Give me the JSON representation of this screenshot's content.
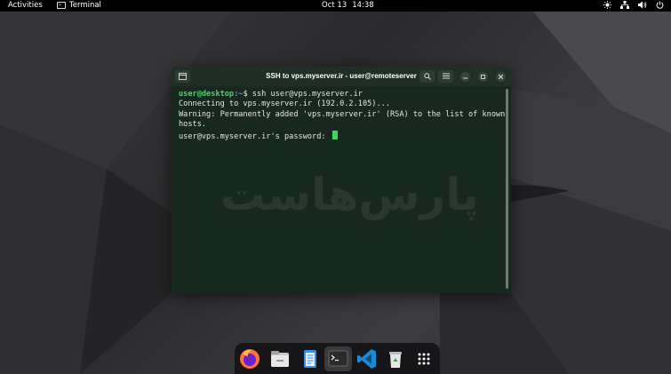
{
  "topbar": {
    "activities": "Activities",
    "app_name": "Terminal",
    "date": "Oct 13",
    "time": "14:38"
  },
  "terminal": {
    "title": "SSH to vps.myserver.ir - user@remoteserver",
    "lines": {
      "l1_user": "user@desktop",
      "l1_path": ":~",
      "l1_cmd": "$ ssh user@vps.myserver.ir",
      "l2": "Connecting to vps.myserver.ir (192.0.2.105)...",
      "l3": "Warning: Permanently added 'vps.myserver.ir' (RSA) to the list of known",
      "l4": "hosts.",
      "l5": "user@vps.myserver.ir's password: "
    },
    "watermark": "پارس‌هاست"
  },
  "dock": {
    "items": [
      "firefox",
      "files",
      "text-editor",
      "terminal",
      "vscode",
      "trash",
      "show-apps"
    ]
  },
  "colors": {
    "terminal_bg": "#17281f",
    "prompt_user": "#4fd16a",
    "prompt_path": "#5c9bf0",
    "cursor": "#3fd36a"
  }
}
